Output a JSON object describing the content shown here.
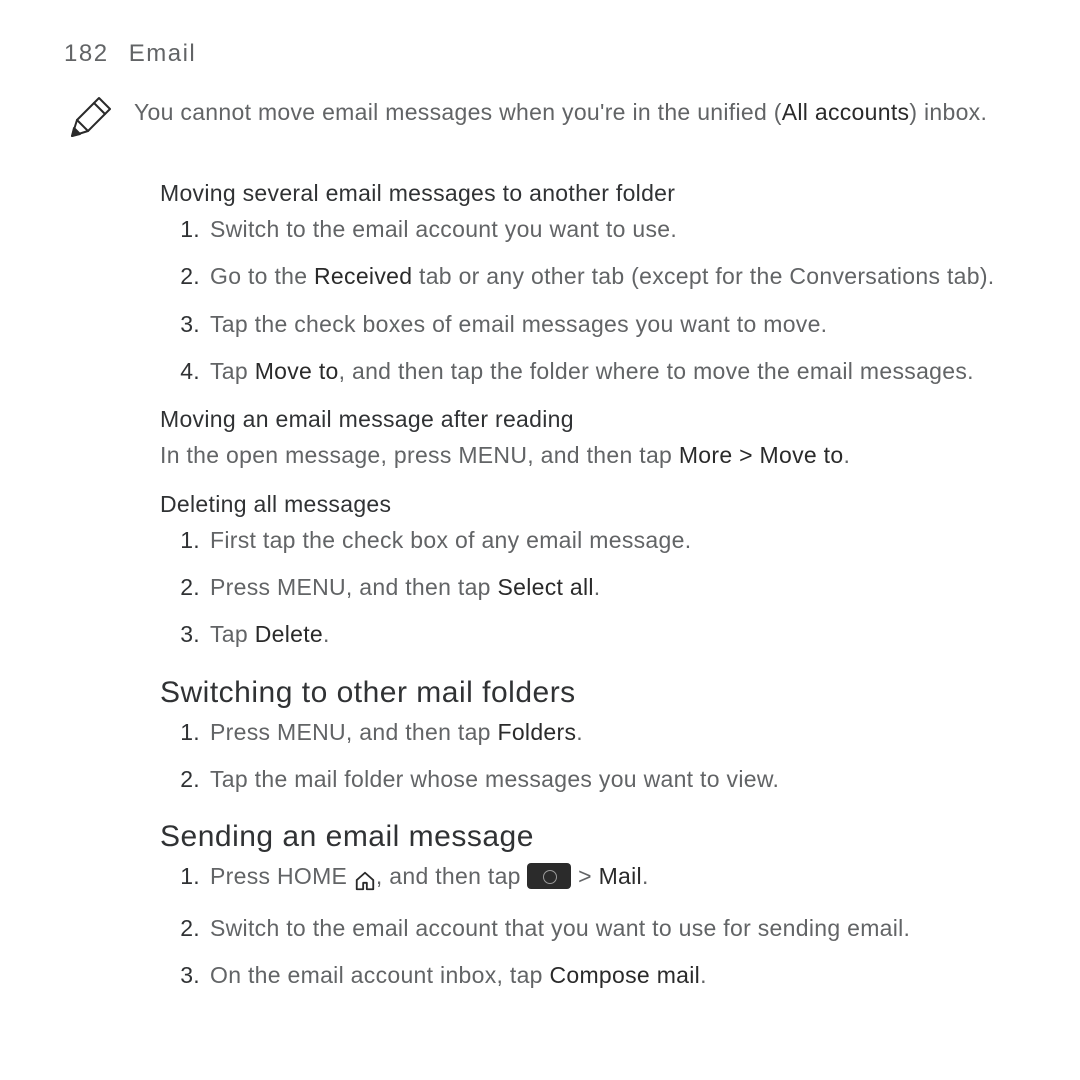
{
  "header": {
    "page_num": "182",
    "chapter": "Email"
  },
  "note": {
    "prefix": "You cannot move email messages when you're in the unified (",
    "bold": "All accounts",
    "suffix": ") inbox."
  },
  "sec_move_several": {
    "heading": "Moving several email messages to another folder",
    "items": {
      "1": {
        "num": "1.",
        "text": "Switch to the email account you want to use."
      },
      "2": {
        "num": "2.",
        "pre": "Go to the ",
        "b1": "Received",
        "post": " tab or any other tab (except for the Conversations tab)."
      },
      "3": {
        "num": "3.",
        "text": "Tap the check boxes of email messages you want to move."
      },
      "4": {
        "num": "4.",
        "pre": "Tap ",
        "b1": "Move to",
        "post": ", and then tap the folder where to move the email messages."
      }
    }
  },
  "sec_move_after": {
    "heading": "Moving an email message after reading",
    "para": {
      "pre": "In the open message, press MENU, and then tap ",
      "b1": "More > Move to",
      "post": "."
    }
  },
  "sec_delete": {
    "heading": "Deleting all messages",
    "items": {
      "1": {
        "num": "1.",
        "text": "First tap the check box of any email message."
      },
      "2": {
        "num": "2.",
        "pre": "Press MENU, and then tap ",
        "b1": "Select all",
        "post": "."
      },
      "3": {
        "num": "3.",
        "pre": "Tap ",
        "b1": "Delete",
        "post": "."
      }
    }
  },
  "sec_switch": {
    "heading": "Switching to other mail folders",
    "items": {
      "1": {
        "num": "1.",
        "pre": "Press MENU, and then tap ",
        "b1": "Folders",
        "post": "."
      },
      "2": {
        "num": "2.",
        "text": "Tap the mail folder whose messages you want to view."
      }
    }
  },
  "sec_send": {
    "heading": "Sending an email message",
    "items": {
      "1": {
        "num": "1.",
        "pre": "Press HOME ",
        "mid": ", and then tap ",
        "gt": " > ",
        "b1": "Mail",
        "post": "."
      },
      "2": {
        "num": "2.",
        "text": "Switch to the email account that you want to use for sending email."
      },
      "3": {
        "num": "3.",
        "pre": "On the email account inbox, tap ",
        "b1": "Compose mail",
        "post": "."
      }
    }
  }
}
